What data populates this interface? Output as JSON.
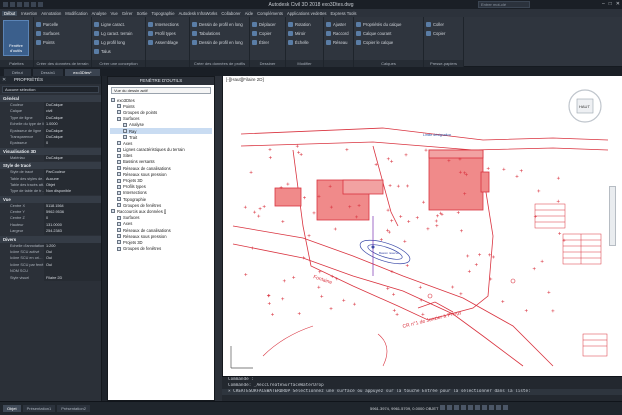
{
  "titlebar": {
    "title": "Autodesk Civil 3D 2018   exo3Dtes.dwg",
    "search_placeholder": "Entrer mot-clé",
    "close": "✕",
    "minimize": "–",
    "maximize": "□"
  },
  "menubar": {
    "items": [
      "Début",
      "Insertion",
      "Annotation",
      "Modification",
      "Analyse",
      "Vue",
      "Gérer",
      "Sortie",
      "Topographie",
      "Autodesk InfraWorks",
      "Collaborer",
      "Aide",
      "Compléments",
      "Applications vedettes",
      "Express Tools"
    ]
  },
  "ribbon": {
    "panels": [
      {
        "label": "Palettes",
        "items": []
      },
      {
        "label": "Créer des données de terrain",
        "items": [
          "Parcelle",
          "Surfaces",
          "Points"
        ]
      },
      {
        "label": "Créer une conception",
        "items": [
          "Ligne caract.",
          "Lg caract. terrain",
          "Lg profil long",
          "Talus"
        ]
      },
      {
        "label": "",
        "items": [
          "Intersections",
          "Profil types",
          "Assemblage"
        ]
      },
      {
        "label": "Créer des données de profils",
        "items": [
          "Dessin de profil en long",
          "Tabulations",
          "Dessin de profil en long"
        ]
      },
      {
        "label": "Dessiner",
        "items": [
          "Déplacer",
          "Copier",
          "Étirer"
        ]
      },
      {
        "label": "Modifier",
        "items": [
          "Rotation",
          "Miroir",
          "Échelle"
        ]
      },
      {
        "label": "",
        "items": [
          "Ajuster",
          "Raccord",
          "Réseau"
        ]
      },
      {
        "label": "Calques",
        "items": [
          "Propriétés du calque",
          "Calque courant",
          "Copier le calque"
        ]
      },
      {
        "label": "Presse-papiers",
        "items": [
          "Coller",
          "Copier"
        ]
      }
    ],
    "big_button": "Fenêtre d'outils"
  },
  "doctabs": [
    "Début",
    "Dessin1",
    "exo3Dtes*"
  ],
  "properties": {
    "header": "PROPRIÉTÉS",
    "selection": "Aucune sélection",
    "sections": [
      {
        "title": "Général",
        "rows": [
          [
            "Couleur",
            "DuCalque"
          ],
          [
            "Calque",
            "civil"
          ],
          [
            "Type de ligne",
            "DuCalque"
          ],
          [
            "Echelle du type de li…",
            "1.0000"
          ],
          [
            "Epaisseur de ligne",
            "DuCalque"
          ],
          [
            "Transparence",
            "DuCalque"
          ],
          [
            "Epaisseur",
            "0"
          ]
        ]
      },
      {
        "title": "Visualisation 3D",
        "rows": [
          [
            "Matériau",
            "DuCalque"
          ]
        ]
      },
      {
        "title": "Style de tracé",
        "rows": [
          [
            "Style de tracé",
            "ParCouleur"
          ],
          [
            "Table des styles de…",
            "Aucune"
          ],
          [
            "Table des tracés att…",
            "Objet"
          ],
          [
            "Type de table de tr…",
            "Non disponible"
          ]
        ]
      },
      {
        "title": "Vue",
        "rows": [
          [
            "Centre X",
            "5118.1564"
          ],
          [
            "Centre Y",
            "5962.9536"
          ],
          [
            "Centre Z",
            "0"
          ],
          [
            "Hauteur",
            "131.0000"
          ],
          [
            "Largeur",
            "254.2383"
          ]
        ]
      },
      {
        "title": "Divers",
        "rows": [
          [
            "Echelle d'annotation",
            "1:200"
          ],
          [
            "Icône SCU activé",
            "Oui"
          ],
          [
            "Icône SCU en ori…",
            "Oui"
          ],
          [
            "Icône SCU par fenê…",
            "Oui"
          ],
          [
            "NOM SCU",
            ""
          ],
          [
            "Style visuel",
            "Filaire 2D"
          ]
        ]
      }
    ]
  },
  "toolspace": {
    "header": "FENÊTRE D'OUTILS",
    "view": "Vue du dessin actif",
    "tree": [
      {
        "label": "exo3Dtes",
        "level": 0
      },
      {
        "label": "Points",
        "level": 1
      },
      {
        "label": "Groupes de points",
        "level": 1
      },
      {
        "label": "Surfaces",
        "level": 1
      },
      {
        "label": "Analyse",
        "level": 2
      },
      {
        "label": "Ray",
        "level": 2
      },
      {
        "label": "Trait",
        "level": 2
      },
      {
        "label": "Axes",
        "level": 1
      },
      {
        "label": "Lignes caractéristiques du terrain",
        "level": 1
      },
      {
        "label": "Sites",
        "level": 1
      },
      {
        "label": "Bassins versants",
        "level": 1
      },
      {
        "label": "Réseaux de canalisations",
        "level": 1
      },
      {
        "label": "Réseaux sous pression",
        "level": 1
      },
      {
        "label": "Projets 3D",
        "level": 1
      },
      {
        "label": "Profils types",
        "level": 1
      },
      {
        "label": "Intersections",
        "level": 1
      },
      {
        "label": "Topographie",
        "level": 1
      },
      {
        "label": "Groupes de fenêtres",
        "level": 1
      },
      {
        "label": "Raccourcis aux données []",
        "level": 0
      },
      {
        "label": "Surfaces",
        "level": 1
      },
      {
        "label": "Axes",
        "level": 1
      },
      {
        "label": "Réseaux de canalisations",
        "level": 1
      },
      {
        "label": "Réseaux sous pression",
        "level": 1
      },
      {
        "label": "Projets 3D",
        "level": 1
      },
      {
        "label": "Groupes de fenêtres",
        "level": 1
      }
    ],
    "selected_index": 5
  },
  "drawing": {
    "viewport_label": "[-][Haut][Filaire 2D]",
    "labels": {
      "limite": "Limite désignation",
      "route": "CR n°1 de Jonzier à Pringy",
      "fontaine": "Fontaine",
      "bassin": "Bassin réservé",
      "parcelle": "Parcelle"
    },
    "accent": "#d9333f",
    "fill": "#f08a8a"
  },
  "cmdline": {
    "line1": "Commande :",
    "line2": "Commande: _AeccCreateSurfaceWaterDrop",
    "line3": "× CREATESURFACEWATERDROP Sélectionnez une surface ou appuyez sur la touche Entrée pour la sélectionner dans la liste:"
  },
  "statusbar": {
    "layout_tabs": [
      "Objet",
      "Présentation1",
      "Présentation2"
    ],
    "coords": "5961.3974, 9961.5709, 0.0000  OBJET",
    "scale": "1:200"
  }
}
